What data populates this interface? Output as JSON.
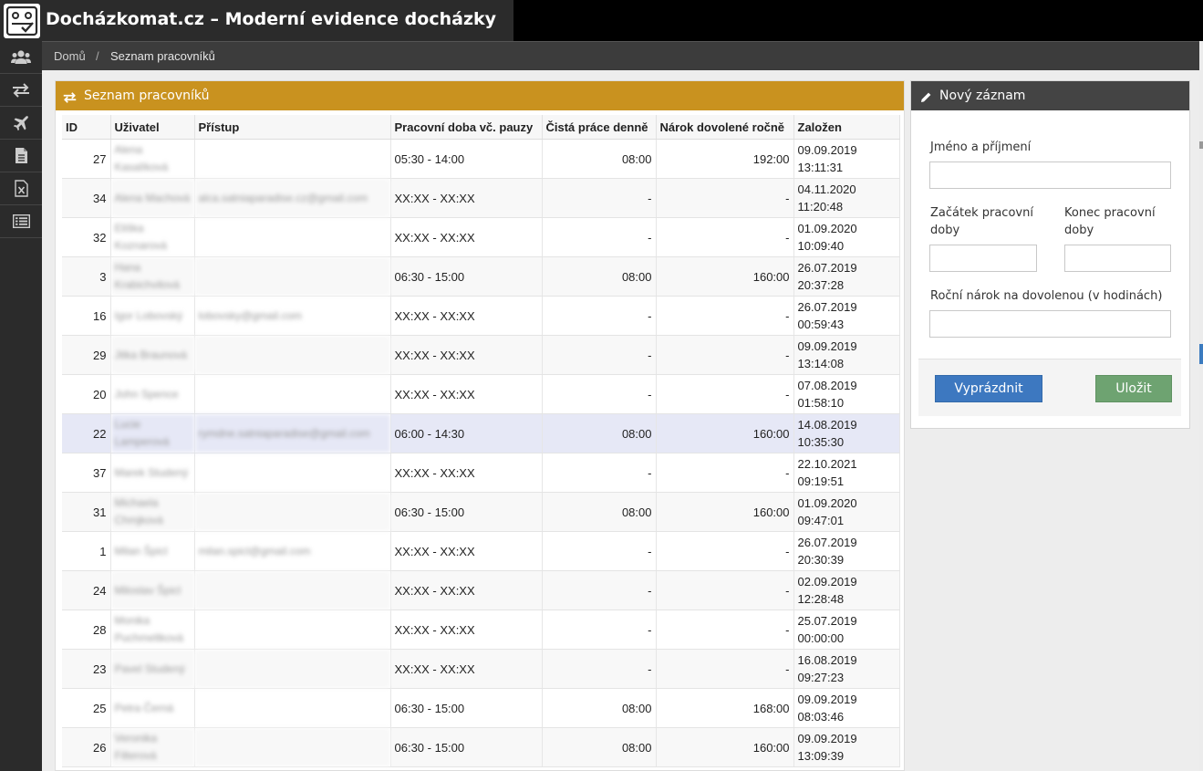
{
  "app": {
    "title": "Docházkomat.cz – Moderní evidence docházky",
    "logo_icon": "attendance-logo-icon"
  },
  "sidebar": {
    "items": [
      {
        "name": "users",
        "icon": "users-icon"
      },
      {
        "name": "transfers",
        "icon": "exchange-icon"
      },
      {
        "name": "vacation",
        "icon": "plane-icon"
      },
      {
        "name": "documents",
        "icon": "document-icon"
      },
      {
        "name": "excel",
        "icon": "excel-icon"
      },
      {
        "name": "list",
        "icon": "list-icon"
      }
    ]
  },
  "breadcrumb": {
    "home": "Domů",
    "separator": "/",
    "current": "Seznam pracovníků"
  },
  "table_panel": {
    "title": "Seznam pracovníků",
    "color": "#c9921f",
    "columns": [
      "ID",
      "Uživatel",
      "Přístup",
      "Pracovní doba vč. pauzy",
      "Čistá práce denně",
      "Nárok dovolené ročně",
      "Založen"
    ],
    "rows": [
      {
        "id": "27",
        "user": "Alena Kasalíková",
        "access": "",
        "hours": "05:30 - 14:00",
        "net": "08:00",
        "vacation": "192:00",
        "date": "09.09.2019",
        "time": "13:11:31"
      },
      {
        "id": "34",
        "user": "Alena Machová",
        "access": "alca.satniaparadise.cz@gmail.com",
        "hours": "XX:XX - XX:XX",
        "net": "-",
        "vacation": "-",
        "date": "04.11.2020",
        "time": "11:20:48"
      },
      {
        "id": "32",
        "user": "Eliška Koznarová",
        "access": "",
        "hours": "XX:XX - XX:XX",
        "net": "-",
        "vacation": "-",
        "date": "01.09.2020",
        "time": "10:09:40"
      },
      {
        "id": "3",
        "user": "Hana Krabichvilová",
        "access": "",
        "hours": "06:30 - 15:00",
        "net": "08:00",
        "vacation": "160:00",
        "date": "26.07.2019",
        "time": "20:37:28"
      },
      {
        "id": "16",
        "user": "Igor Lobovský",
        "access": "lobovsky@gmail.com",
        "hours": "XX:XX - XX:XX",
        "net": "-",
        "vacation": "-",
        "date": "26.07.2019",
        "time": "00:59:43"
      },
      {
        "id": "29",
        "user": "Jitka Braunová",
        "access": "",
        "hours": "XX:XX - XX:XX",
        "net": "-",
        "vacation": "-",
        "date": "09.09.2019",
        "time": "13:14:08"
      },
      {
        "id": "20",
        "user": "John Spence",
        "access": "",
        "hours": "XX:XX - XX:XX",
        "net": "-",
        "vacation": "-",
        "date": "07.08.2019",
        "time": "01:58:10"
      },
      {
        "id": "22",
        "user": "Lucie Lamperová",
        "access": "rymdne.satniaparadise@gmail.com",
        "hours": "06:00 - 14:30",
        "net": "08:00",
        "vacation": "160:00",
        "date": "14.08.2019",
        "time": "10:35:30",
        "selected": true
      },
      {
        "id": "37",
        "user": "Marek Studený",
        "access": "",
        "hours": "XX:XX - XX:XX",
        "net": "-",
        "vacation": "-",
        "date": "22.10.2021",
        "time": "09:19:51"
      },
      {
        "id": "31",
        "user": "Michaela Chmjková",
        "access": "",
        "hours": "06:30 - 15:00",
        "net": "08:00",
        "vacation": "160:00",
        "date": "01.09.2020",
        "time": "09:47:01"
      },
      {
        "id": "1",
        "user": "Milan Špicl",
        "access": "milan.spicl@gmail.com",
        "hours": "XX:XX - XX:XX",
        "net": "-",
        "vacation": "-",
        "date": "26.07.2019",
        "time": "20:30:39"
      },
      {
        "id": "24",
        "user": "Miloslav Špicl",
        "access": "",
        "hours": "XX:XX - XX:XX",
        "net": "-",
        "vacation": "-",
        "date": "02.09.2019",
        "time": "12:28:48"
      },
      {
        "id": "28",
        "user": "Monika Puchmeltková",
        "access": "",
        "hours": "XX:XX - XX:XX",
        "net": "-",
        "vacation": "-",
        "date": "25.07.2019",
        "time": "00:00:00"
      },
      {
        "id": "23",
        "user": "Pavel Studený",
        "access": "",
        "hours": "XX:XX - XX:XX",
        "net": "-",
        "vacation": "-",
        "date": "16.08.2019",
        "time": "09:27:23"
      },
      {
        "id": "25",
        "user": "Petra Černá",
        "access": "",
        "hours": "06:30 - 15:00",
        "net": "08:00",
        "vacation": "168:00",
        "date": "09.09.2019",
        "time": "08:03:46"
      },
      {
        "id": "26",
        "user": "Veronika Filterová",
        "access": "",
        "hours": "06:30 - 15:00",
        "net": "08:00",
        "vacation": "160:00",
        "date": "09.09.2019",
        "time": "13:09:39"
      }
    ]
  },
  "form": {
    "title": "Nový záznam",
    "name_label": "Jméno a příjmení",
    "start_label": "Začátek pracovní doby",
    "end_label": "Konec pracovní doby",
    "vacation_label": "Roční nárok na dovolenou (v hodinách)",
    "name_value": "",
    "start_value": "",
    "end_value": "",
    "vacation_value": "",
    "clear_button": "Vyprázdnit",
    "save_button": "Uložit",
    "clear_color": "#3d78c0",
    "save_color": "#6ea371"
  }
}
